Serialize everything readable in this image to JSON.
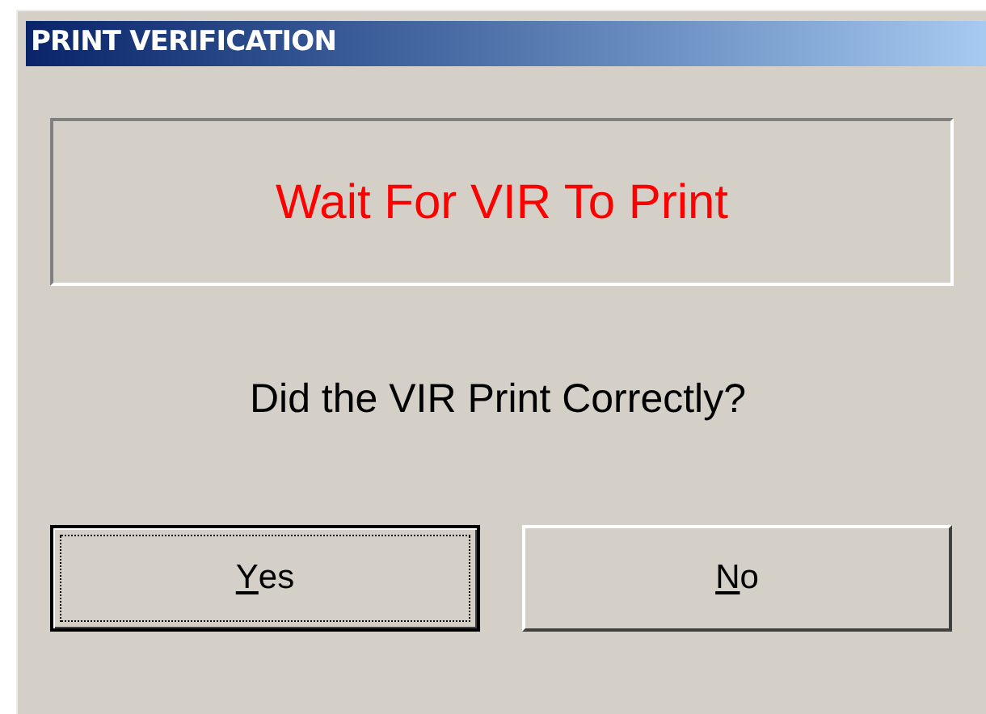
{
  "window": {
    "title": "PRINT VERIFICATION"
  },
  "status_panel": {
    "message": "Wait For VIR To Print"
  },
  "question": "Did the VIR Print Correctly?",
  "buttons": [
    {
      "label": "Yes",
      "default": true,
      "mnemonic_underlined": true
    },
    {
      "label": "No",
      "default": false,
      "mnemonic_underlined": true
    }
  ]
}
